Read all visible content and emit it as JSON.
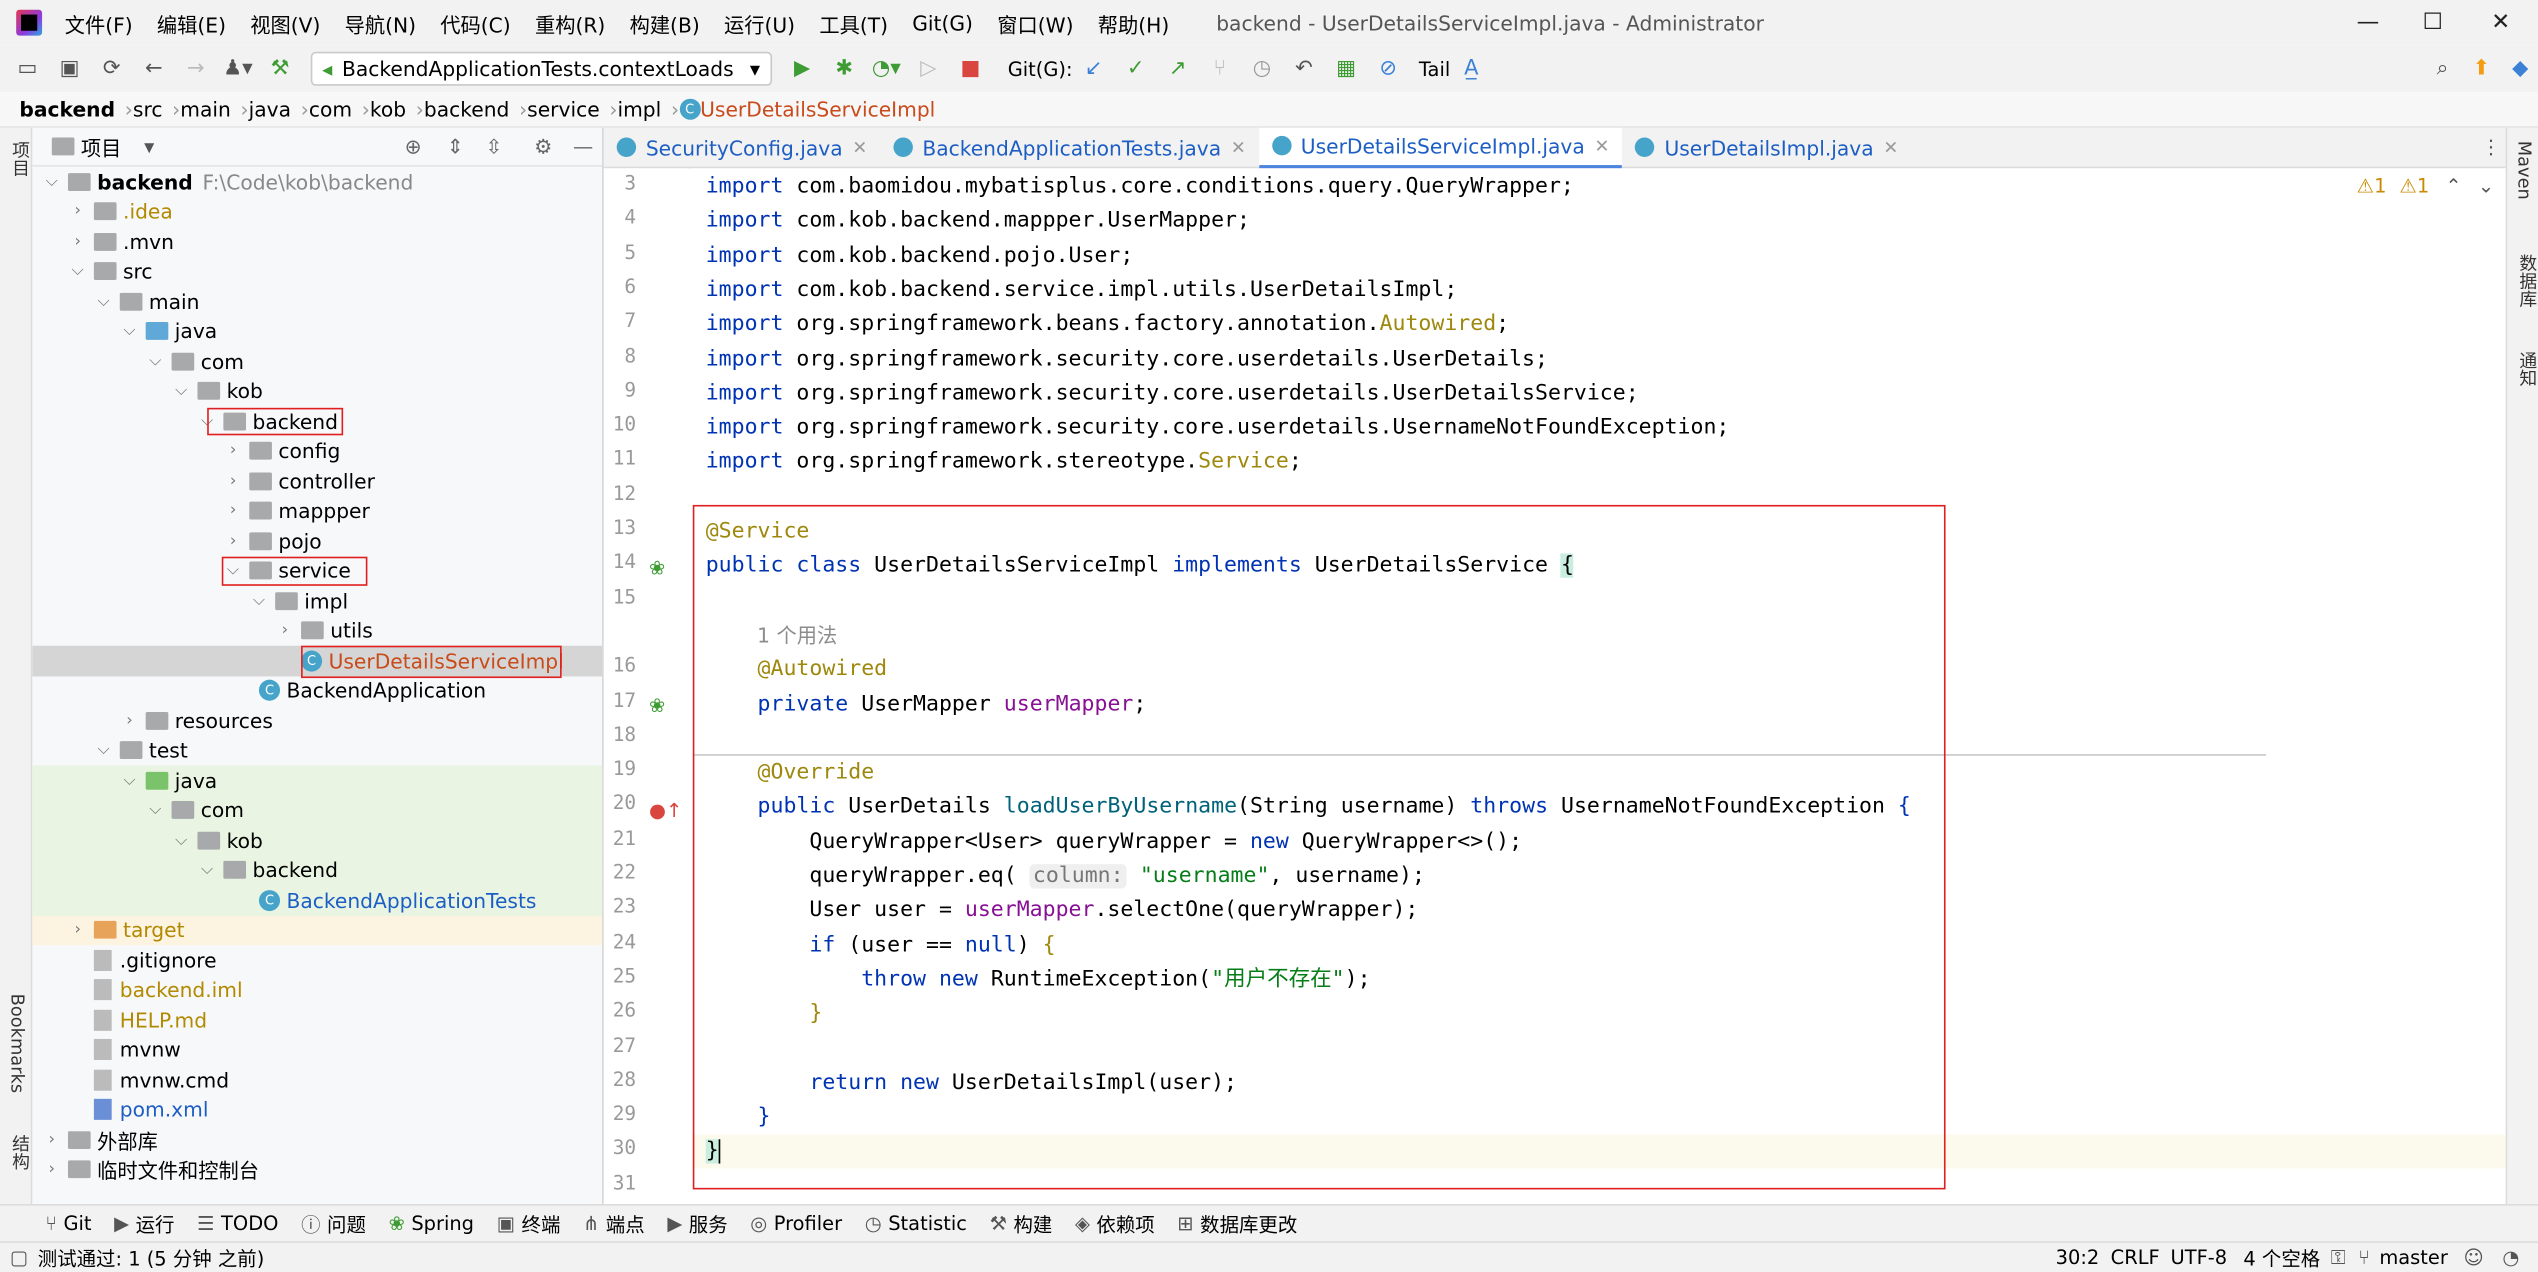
{
  "window": {
    "title": "backend - UserDetailsServiceImpl.java - Administrator"
  },
  "menu": [
    "文件(F)",
    "编辑(E)",
    "视图(V)",
    "导航(N)",
    "代码(C)",
    "重构(R)",
    "构建(B)",
    "运行(U)",
    "工具(T)",
    "Git(G)",
    "窗口(W)",
    "帮助(H)"
  ],
  "toolbar": {
    "run_config": "BackendApplicationTests.contextLoads",
    "git_label": "Git(G):",
    "tail_label": "Tail"
  },
  "breadcrumb": [
    "backend",
    "src",
    "main",
    "java",
    "com",
    "kob",
    "backend",
    "service",
    "impl",
    "UserDetailsServiceImpl"
  ],
  "project": {
    "header": "项目",
    "root_path": "F:\\Code\\kob\\backend",
    "items": [
      {
        "label": "backend"
      },
      {
        "label": ".idea"
      },
      {
        "label": ".mvn"
      },
      {
        "label": "src"
      },
      {
        "label": "main"
      },
      {
        "label": "java"
      },
      {
        "label": "com"
      },
      {
        "label": "kob"
      },
      {
        "label": "backend"
      },
      {
        "label": "config"
      },
      {
        "label": "controller"
      },
      {
        "label": "mappper"
      },
      {
        "label": "pojo"
      },
      {
        "label": "service"
      },
      {
        "label": "impl"
      },
      {
        "label": "utils"
      },
      {
        "label": "UserDetailsServiceImpl"
      },
      {
        "label": "BackendApplication"
      },
      {
        "label": "resources"
      },
      {
        "label": "test"
      },
      {
        "label": "java"
      },
      {
        "label": "com"
      },
      {
        "label": "kob"
      },
      {
        "label": "backend"
      },
      {
        "label": "BackendApplicationTests"
      },
      {
        "label": "target"
      },
      {
        "label": ".gitignore"
      },
      {
        "label": "backend.iml"
      },
      {
        "label": "HELP.md"
      },
      {
        "label": "mvnw"
      },
      {
        "label": "mvnw.cmd"
      },
      {
        "label": "pom.xml"
      },
      {
        "label": "外部库"
      },
      {
        "label": "临时文件和控制台"
      }
    ]
  },
  "tabs": [
    "SecurityConfig.java",
    "BackendApplicationTests.java",
    "UserDetailsServiceImpl.java",
    "UserDetailsImpl.java"
  ],
  "editor": {
    "warnings": [
      "1",
      "1"
    ],
    "usage_hint": "1 个用法",
    "param_hint": "column:",
    "line_numbers": [
      "3",
      "4",
      "5",
      "6",
      "7",
      "8",
      "9",
      "10",
      "11",
      "12",
      "13",
      "14",
      "15",
      "",
      "16",
      "17",
      "18",
      "19",
      "20",
      "21",
      "22",
      "23",
      "24",
      "25",
      "26",
      "27",
      "28",
      "29",
      "30",
      "31"
    ]
  },
  "left_strip": {
    "project": "项目",
    "bookmarks": "Bookmarks",
    "structure": "结构"
  },
  "right_strip": {
    "maven": "Maven",
    "db": "数据库",
    "notify": "通知"
  },
  "bottom_tools": [
    "Git",
    "运行",
    "TODO",
    "问题",
    "Spring",
    "终端",
    "端点",
    "服务",
    "Profiler",
    "Statistic",
    "构建",
    "依赖项",
    "数据库更改"
  ],
  "status": {
    "message": "测试通过: 1 (5 分钟 之前)",
    "position": "30:2",
    "line_sep": "CRLF",
    "encoding": "UTF-8",
    "indent": "4 个空格",
    "branch": "master"
  }
}
